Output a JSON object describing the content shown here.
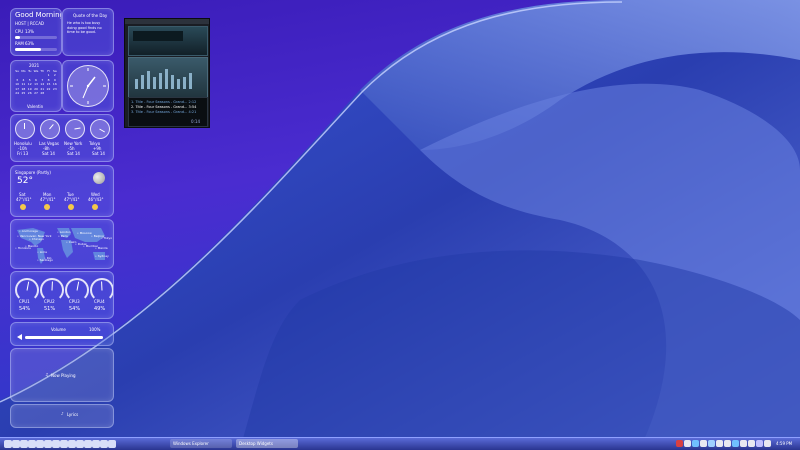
{
  "greeting": {
    "title": "Good Morning",
    "user": "HOST | RCCAD",
    "cpu_label": "CPU",
    "cpu_value": "13%",
    "cpu_fraction": 0.13,
    "ram_label": "RAM",
    "ram_value": "63%",
    "ram_fraction": 0.63
  },
  "quote": {
    "title": "Quote of the Day",
    "text": "He who is too busy doing good finds no time to be good."
  },
  "calendar": {
    "header": "2021",
    "days": [
      "Su",
      "Mo",
      "Tu",
      "We",
      "Th",
      "Fr",
      "Sa"
    ],
    "dates": [
      "",
      "",
      "",
      "",
      "",
      "1",
      "2",
      "3",
      "4",
      "5",
      "6",
      "7",
      "8",
      "9",
      "10",
      "11",
      "12",
      "13",
      "14",
      "15",
      "16",
      "17",
      "18",
      "19",
      "20",
      "21",
      "22",
      "23",
      "24",
      "25",
      "26",
      "27",
      "28"
    ],
    "footer": "Valentin"
  },
  "world_clocks": [
    {
      "city": "Honolulu",
      "offset": "-10h",
      "date": "Fri 13"
    },
    {
      "city": "Las Vegas",
      "offset": "-8h",
      "date": "Sat 14"
    },
    {
      "city": "New York",
      "offset": "-5h",
      "date": "Sat 14"
    },
    {
      "city": "Tokyo",
      "offset": "+9h",
      "date": "Sat 14"
    }
  ],
  "weather": {
    "location": "Singapore (Partly)",
    "temperature": "52°",
    "forecast": [
      {
        "day": "Sat",
        "range": "47°/41°"
      },
      {
        "day": "Mon",
        "range": "47°/41°"
      },
      {
        "day": "Tue",
        "range": "47°/41°"
      },
      {
        "day": "Wed",
        "range": "46°/43°"
      }
    ]
  },
  "map_labels": [
    "Anchorage",
    "Vancouver",
    "Chicago",
    "New York",
    "Mexico",
    "Lima",
    "Santiago",
    "Rio",
    "London",
    "Paris",
    "Cairo",
    "Dubai",
    "Mumbai",
    "Moscow",
    "Beijing",
    "Tokyo",
    "Sydney",
    "Manila",
    "Honolulu"
  ],
  "cpu_meters": [
    {
      "label": "CPU1",
      "value": "54%",
      "fraction": 0.54
    },
    {
      "label": "CPU2",
      "value": "51%",
      "fraction": 0.51
    },
    {
      "label": "CPU3",
      "value": "54%",
      "fraction": 0.54
    },
    {
      "label": "CPU4",
      "value": "49%",
      "fraction": 0.49
    }
  ],
  "volume": {
    "label": "Volume",
    "value": "100%",
    "fraction": 1.0
  },
  "now_playing": {
    "label": "Now Playing"
  },
  "lyrics": {
    "label": "Lyrics"
  },
  "player": {
    "playlist": [
      "1. Title - Four Seasons - Grand...  2:12",
      "2. Title - Four Seasons - Grand...  3:54",
      "3. Title - Four Seasons - Grand...  4:21"
    ],
    "time": "0:14"
  },
  "taskbar": {
    "tasks": [
      "Windows Explorer",
      "Desktop Widgets"
    ],
    "clock": "4:59 PM"
  }
}
